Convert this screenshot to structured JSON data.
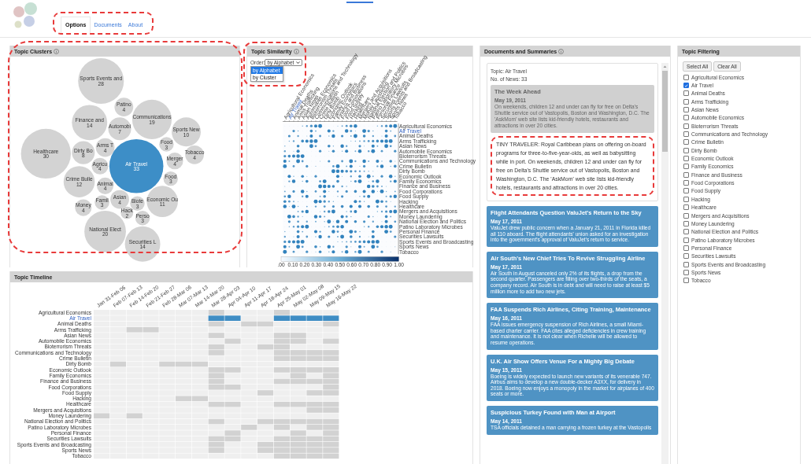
{
  "tabs": [
    {
      "label": "Options",
      "selected": true
    },
    {
      "label": "Documents",
      "selected": false
    },
    {
      "label": "About",
      "selected": false
    }
  ],
  "clusters": {
    "title": "Topic Clusters",
    "bubbles": [
      {
        "label": "Sports Events and",
        "count": "28",
        "selected": false
      },
      {
        "label": "Patino",
        "count": "4",
        "selected": false
      },
      {
        "label": "Finance and",
        "count": "14",
        "selected": false
      },
      {
        "label": "Automobi",
        "count": "7",
        "selected": false
      },
      {
        "label": "Communications",
        "count": "19",
        "selected": false
      },
      {
        "label": "Sports New",
        "count": "10",
        "selected": false
      },
      {
        "label": "Healthcare",
        "count": "30",
        "selected": false
      },
      {
        "label": "Dirty Bo",
        "count": "8",
        "selected": false
      },
      {
        "label": "Arms T",
        "count": "4",
        "selected": false
      },
      {
        "label": "Agricu",
        "count": "4",
        "selected": false
      },
      {
        "label": "Air Travel",
        "count": "33",
        "selected": true
      },
      {
        "label": "Food",
        "count": "3",
        "selected": false
      },
      {
        "label": "Merger",
        "count": "4",
        "selected": false
      },
      {
        "label": "Tobacco",
        "count": "4",
        "selected": false
      },
      {
        "label": "Crime Bulle",
        "count": "12",
        "selected": false
      },
      {
        "label": "Food",
        "count": "3",
        "selected": false
      },
      {
        "label": "Animal",
        "count": "4",
        "selected": false
      },
      {
        "label": "Money",
        "count": "4",
        "selected": false
      },
      {
        "label": "Famil",
        "count": "3",
        "selected": false
      },
      {
        "label": "Asian",
        "count": "4",
        "selected": false
      },
      {
        "label": "Biote",
        "count": "3",
        "selected": false
      },
      {
        "label": "Economic Ou",
        "count": "11",
        "selected": false
      },
      {
        "label": "National Elect",
        "count": "20",
        "selected": false
      },
      {
        "label": "Hack",
        "count": "2",
        "selected": false
      },
      {
        "label": "Perso",
        "count": "3",
        "selected": false
      },
      {
        "label": "Securities L",
        "count": "14",
        "selected": false
      }
    ]
  },
  "similarity": {
    "title": "Topic Similarity",
    "order_label": "Order:",
    "order_value": "by Alphabet",
    "order_options": [
      {
        "label": "by Alphabet",
        "selected": true
      },
      {
        "label": "by Cluster",
        "selected": false
      }
    ],
    "columns": [
      "Agricultural Economics",
      "Air Travel",
      "Animal Deaths",
      "Arms Trafficking",
      "Asian News",
      "Automobile Economics",
      "Bioterrorism Threats",
      "Communications and Technology",
      "Crime Bulletin",
      "Dirty Bomb",
      "Economic Outlook",
      "Family Economics",
      "Finance and Business",
      "Food Corporations",
      "Food Supply",
      "Hacking",
      "Healthcare",
      "Mergers and Acquisitions",
      "Money Laundering",
      "National Election and Politics",
      "Patino Laboratory Microbes",
      "Personal Finance",
      "Securities Lawsuits",
      "Sports Events and Broadcasting",
      "Sports News",
      "Tobacco"
    ],
    "rows": [
      {
        "label": "Agricultural Economics",
        "selected": false
      },
      {
        "label": "Air Travel",
        "selected": true
      },
      {
        "label": "Animal Deaths",
        "selected": false
      },
      {
        "label": "Arms Trafficking",
        "selected": false
      },
      {
        "label": "Asian News",
        "selected": false
      },
      {
        "label": "Automobile Economics",
        "selected": false
      },
      {
        "label": "Bioterrorism Threats",
        "selected": false
      },
      {
        "label": "Communications and Technology",
        "selected": false
      },
      {
        "label": "Crime Bulletin",
        "selected": false
      },
      {
        "label": "Dirty Bomb",
        "selected": false
      },
      {
        "label": "Economic Outlook",
        "selected": false
      },
      {
        "label": "Family Economics",
        "selected": false
      },
      {
        "label": "Finance and Business",
        "selected": false
      },
      {
        "label": "Food Corporations",
        "selected": false
      },
      {
        "label": "Food Supply",
        "selected": false
      },
      {
        "label": "Hacking",
        "selected": false
      },
      {
        "label": "Healthcare",
        "selected": false
      },
      {
        "label": "Mergers and Acquisitions",
        "selected": false
      },
      {
        "label": "Money Laundering",
        "selected": false
      },
      {
        "label": "National Election and Politics",
        "selected": false
      },
      {
        "label": "Patino Laboratory Microbes",
        "selected": false
      },
      {
        "label": "Personal Finance",
        "selected": false
      },
      {
        "label": "Securities Lawsuits",
        "selected": false
      },
      {
        "label": "Sports Events and Broadcasting",
        "selected": false
      },
      {
        "label": "Sports News",
        "selected": false
      },
      {
        "label": "Tobacco",
        "selected": false
      }
    ],
    "scale_ticks": [
      ".00",
      "0.10",
      "0.20",
      "0.30",
      "0.40",
      "0.50",
      "0.60",
      "0.70",
      "0.80",
      "0.90",
      "1.00"
    ]
  },
  "timeline": {
    "title": "Topic Timeline",
    "columns": [
      "Jan 31-Feb 06",
      "Feb 07-Feb 13",
      "Feb 14-Feb 20",
      "Feb 21-Feb 27",
      "Feb 28-Mar 06",
      "Mar 07-Mar 13",
      "Mar 14-Mar 20",
      "Mar 28-Apr 03",
      "Apr 04-Apr 10",
      "Apr 11-Apr 17",
      "Apr 18-Apr 24",
      "Apr 25-May 01",
      "May 02-May 08",
      "May 09-May 15",
      "May 16-May 22"
    ],
    "rows": [
      {
        "label": "Agricultural Economics",
        "selected": false,
        "cells": [
          false,
          false,
          false,
          false,
          false,
          false,
          false,
          true,
          false,
          false,
          false,
          true,
          false,
          false,
          false
        ]
      },
      {
        "label": "Air Travel",
        "selected": true,
        "cells": [
          false,
          false,
          false,
          false,
          false,
          false,
          false,
          true,
          true,
          false,
          false,
          true,
          true,
          true,
          true
        ]
      },
      {
        "label": "Animal Deaths",
        "selected": false,
        "cells": [
          false,
          false,
          false,
          false,
          false,
          false,
          false,
          true,
          false,
          true,
          true,
          false,
          false,
          false,
          true
        ]
      },
      {
        "label": "Arms Trafficking",
        "selected": false,
        "cells": [
          false,
          false,
          true,
          true,
          false,
          false,
          false,
          false,
          false,
          false,
          false,
          false,
          false,
          false,
          false
        ]
      },
      {
        "label": "Asian News",
        "selected": false,
        "cells": [
          false,
          false,
          false,
          false,
          false,
          false,
          false,
          true,
          false,
          false,
          false,
          true,
          true,
          false,
          false
        ]
      },
      {
        "label": "Automobile Economics",
        "selected": false,
        "cells": [
          false,
          false,
          false,
          false,
          false,
          false,
          false,
          false,
          true,
          false,
          false,
          true,
          true,
          false,
          true
        ]
      },
      {
        "label": "Bioterrorism Threats",
        "selected": false,
        "cells": [
          false,
          false,
          false,
          false,
          false,
          false,
          false,
          true,
          false,
          false,
          true,
          true,
          false,
          false,
          false
        ]
      },
      {
        "label": "Communications and Technology",
        "selected": false,
        "cells": [
          false,
          false,
          false,
          false,
          false,
          false,
          false,
          true,
          false,
          false,
          false,
          true,
          true,
          true,
          true
        ]
      },
      {
        "label": "Crime Bulletin",
        "selected": false,
        "cells": [
          false,
          false,
          false,
          false,
          false,
          false,
          false,
          false,
          false,
          false,
          false,
          true,
          true,
          true,
          true
        ]
      },
      {
        "label": "Dirty Bomb",
        "selected": false,
        "cells": [
          false,
          true,
          false,
          false,
          true,
          true,
          true,
          false,
          false,
          false,
          false,
          false,
          false,
          false,
          false
        ]
      },
      {
        "label": "Economic Outlook",
        "selected": false,
        "cells": [
          false,
          false,
          false,
          false,
          false,
          false,
          false,
          true,
          true,
          false,
          false,
          true,
          true,
          true,
          true
        ]
      },
      {
        "label": "Family Economics",
        "selected": false,
        "cells": [
          false,
          false,
          false,
          false,
          false,
          false,
          false,
          true,
          false,
          false,
          false,
          false,
          true,
          false,
          true
        ]
      },
      {
        "label": "Finance and Business",
        "selected": false,
        "cells": [
          false,
          false,
          false,
          false,
          false,
          false,
          false,
          true,
          false,
          false,
          false,
          true,
          true,
          true,
          true
        ]
      },
      {
        "label": "Food Corporations",
        "selected": false,
        "cells": [
          false,
          false,
          false,
          false,
          false,
          false,
          false,
          true,
          true,
          false,
          false,
          false,
          false,
          false,
          true
        ]
      },
      {
        "label": "Food Supply",
        "selected": false,
        "cells": [
          false,
          false,
          false,
          false,
          false,
          false,
          false,
          false,
          false,
          false,
          true,
          false,
          false,
          true,
          true
        ]
      },
      {
        "label": "Hacking",
        "selected": false,
        "cells": [
          false,
          false,
          false,
          false,
          false,
          true,
          true,
          false,
          false,
          false,
          false,
          false,
          false,
          false,
          false
        ]
      },
      {
        "label": "Healthcare",
        "selected": false,
        "cells": [
          false,
          false,
          false,
          false,
          false,
          false,
          false,
          true,
          true,
          false,
          false,
          true,
          true,
          true,
          true
        ]
      },
      {
        "label": "Mergers and Acquisitions",
        "selected": false,
        "cells": [
          false,
          false,
          false,
          false,
          false,
          false,
          false,
          false,
          false,
          false,
          false,
          false,
          false,
          true,
          true
        ]
      },
      {
        "label": "Money Laundering",
        "selected": false,
        "cells": [
          true,
          false,
          true,
          false,
          false,
          false,
          false,
          false,
          false,
          false,
          false,
          false,
          false,
          false,
          false
        ]
      },
      {
        "label": "National Election and Politics",
        "selected": false,
        "cells": [
          false,
          false,
          false,
          false,
          false,
          false,
          false,
          true,
          false,
          false,
          true,
          true,
          true,
          true,
          true
        ]
      },
      {
        "label": "Patino Laboratory Microbes",
        "selected": false,
        "cells": [
          false,
          false,
          false,
          false,
          false,
          false,
          false,
          false,
          false,
          true,
          false,
          true,
          false,
          true,
          true
        ]
      },
      {
        "label": "Personal Finance",
        "selected": false,
        "cells": [
          false,
          false,
          false,
          false,
          false,
          false,
          false,
          false,
          true,
          false,
          false,
          false,
          true,
          false,
          true
        ]
      },
      {
        "label": "Securities Lawsuits",
        "selected": false,
        "cells": [
          false,
          false,
          false,
          false,
          false,
          false,
          false,
          true,
          true,
          false,
          false,
          true,
          true,
          true,
          true
        ]
      },
      {
        "label": "Sports Events and Broadcasting",
        "selected": false,
        "cells": [
          false,
          false,
          false,
          false,
          false,
          false,
          false,
          true,
          false,
          false,
          true,
          true,
          true,
          true,
          true
        ]
      },
      {
        "label": "Sports News",
        "selected": false,
        "cells": [
          false,
          false,
          false,
          false,
          false,
          false,
          false,
          true,
          false,
          false,
          true,
          true,
          true,
          true,
          true
        ]
      },
      {
        "label": "Tobacco",
        "selected": false,
        "cells": [
          false,
          false,
          false,
          false,
          false,
          false,
          false,
          false,
          false,
          false,
          false,
          true,
          true,
          true,
          true
        ]
      }
    ]
  },
  "documents": {
    "title": "Documents and Summaries",
    "topic": "Topic: Air Travel",
    "count": "No. of News: 33",
    "items": [
      {
        "title": "The Week Ahead",
        "date": "May 19, 2011",
        "text": "On weekends, children 12 and under can fly for free on Delta's Shuttle service out of Vastopolis, Boston and Washington, D.C. The 'AskMom' web site lists kid-friendly hotels, restaurants and attractions in over 20 cities.",
        "summary": "TINY TRAVELER: Royal Caribbean plans on offering on-board programs for three-to-five-year-olds, as well as babysitting while in port. On weekends, children 12 and under can fly for free on Delta's Shuttle service out of Vastopolis, Boston and Washington, D.C. The 'AskMom' web site lists kid-friendly hotels, restaurants and attractions in over 20 cities.",
        "selected": true
      },
      {
        "title": "Flight Attendants Question ValuJet's Return to the Sky",
        "date": "May 17, 2011",
        "text": "ValuJet drew public concern when a January 21, 2011 in Florida killed all 110 aboard. The flight attendants' union asked for an investigation into the government's approval of ValuJet's return to service.",
        "selected": false
      },
      {
        "title": "Air South's New Chief Tries To Revive Struggling Airline",
        "date": "May 17, 2011",
        "text": "Air South in August canceled only 2% of its flights, a drop from the second quarter. Passengers are filling over two-thirds of the seats, a company record. Air South is in debt and will need to raise at least $5 million more to add two new jets.",
        "selected": false
      },
      {
        "title": "FAA Suspends Rich Airlines, Citing Training, Maintenance",
        "date": "May 16, 2011",
        "text": "FAA issues emergency suspension of Rich Airlines, a small Miami-based charter carrier. FAA cites alleged deficiencies in crew training and maintenance. It is not clear when Richelle will be allowed to resume operations.",
        "selected": false
      },
      {
        "title": "U.K. Air Show Offers Venue For a Mighty Big Debate",
        "date": "May 15, 2011",
        "text": "Boeing is widely expected to launch new variants of its venerable 747. Airbus aims to develop a new double-decker A3XX, for delivery in 2018. Boeing now enjoys a monopoly in the market for airplanes of 400 seats or more.",
        "selected": false
      },
      {
        "title": "Suspicious Turkey Found with Man at Airport",
        "date": "May 14, 2011",
        "text": "TSA officials detained a man carrying a frozen turkey at the Vastopolis",
        "selected": false
      }
    ]
  },
  "filtering": {
    "title": "Topic Filtering",
    "buttons": [
      "Select All",
      "Clear All"
    ],
    "topics": [
      {
        "label": "Agricultural Economics",
        "checked": false
      },
      {
        "label": "Air Travel",
        "checked": true
      },
      {
        "label": "Animal Deaths",
        "checked": false
      },
      {
        "label": "Arms Trafficking",
        "checked": false
      },
      {
        "label": "Asian News",
        "checked": false
      },
      {
        "label": "Automobile Economics",
        "checked": false
      },
      {
        "label": "Bioterrorism Threats",
        "checked": false
      },
      {
        "label": "Communications and Technology",
        "checked": false
      },
      {
        "label": "Crime Bulletin",
        "checked": false
      },
      {
        "label": "Dirty Bomb",
        "checked": false
      },
      {
        "label": "Economic Outlook",
        "checked": false
      },
      {
        "label": "Family Economics",
        "checked": false
      },
      {
        "label": "Finance and Business",
        "checked": false
      },
      {
        "label": "Food Corporations",
        "checked": false
      },
      {
        "label": "Food Supply",
        "checked": false
      },
      {
        "label": "Hacking",
        "checked": false
      },
      {
        "label": "Healthcare",
        "checked": false
      },
      {
        "label": "Mergers and Acquisitions",
        "checked": false
      },
      {
        "label": "Money Laundering",
        "checked": false
      },
      {
        "label": "National Election and Politics",
        "checked": false
      },
      {
        "label": "Patino Laboratory Microbes",
        "checked": false
      },
      {
        "label": "Personal Finance",
        "checked": false
      },
      {
        "label": "Securities Lawsuits",
        "checked": false
      },
      {
        "label": "Sports Events and Broadcasting",
        "checked": false
      },
      {
        "label": "Sports News",
        "checked": false
      },
      {
        "label": "Tobacco",
        "checked": false
      }
    ]
  }
}
